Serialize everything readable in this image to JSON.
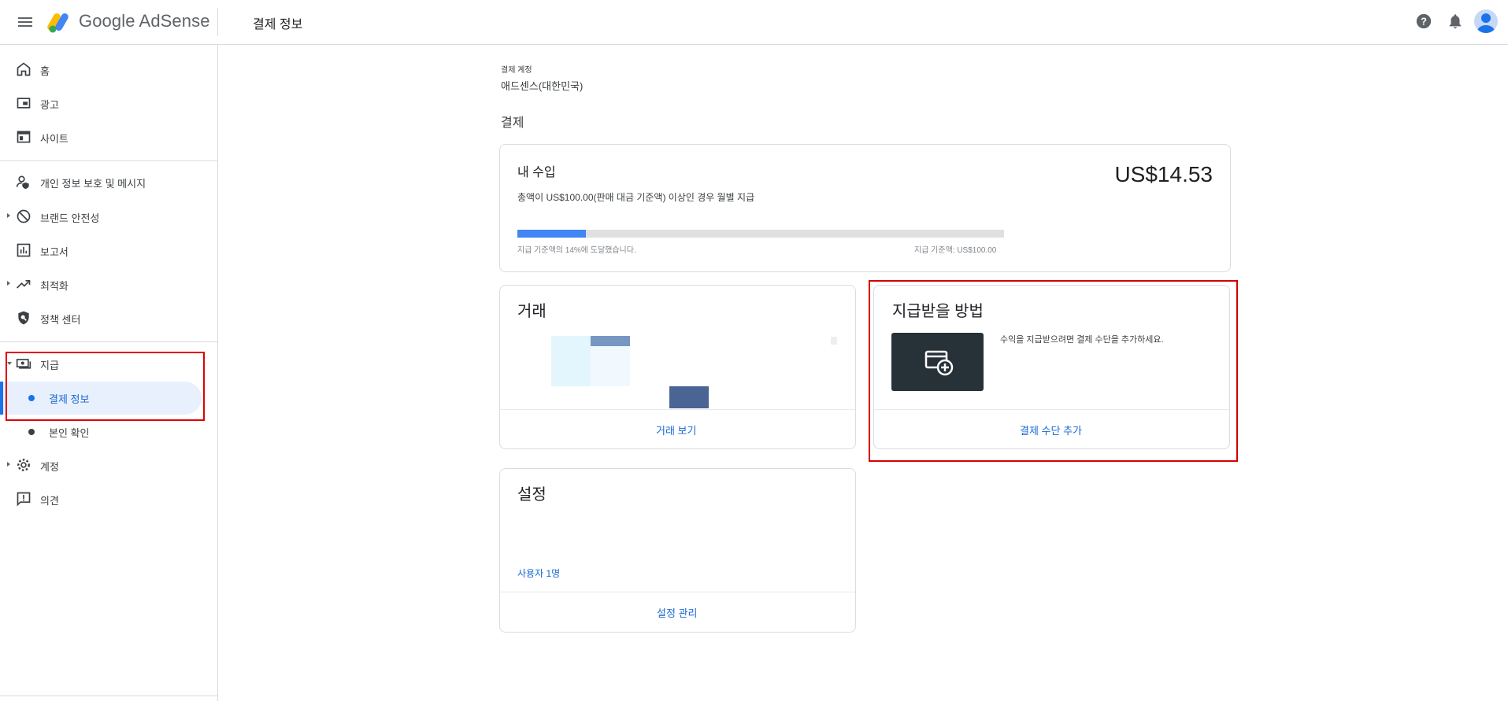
{
  "header": {
    "brand_google": "Google",
    "brand_product": "AdSense",
    "page_title": "결제 정보"
  },
  "sidebar": {
    "items": [
      {
        "label": "홈",
        "icon": "home-icon"
      },
      {
        "label": "광고",
        "icon": "ads-icon"
      },
      {
        "label": "사이트",
        "icon": "sites-icon"
      },
      {
        "label": "개인 정보 보호 및 메시지",
        "icon": "privacy-icon"
      },
      {
        "label": "브랜드 안전성",
        "icon": "block-icon"
      },
      {
        "label": "보고서",
        "icon": "reports-icon"
      },
      {
        "label": "최적화",
        "icon": "trending-icon"
      },
      {
        "label": "정책 센터",
        "icon": "policy-icon"
      },
      {
        "label": "지급",
        "icon": "payments-icon"
      },
      {
        "label": "계정",
        "icon": "gear-icon"
      },
      {
        "label": "의견",
        "icon": "feedback-icon"
      }
    ],
    "sub_items": [
      {
        "label": "결제 정보"
      },
      {
        "label": "본인 확인"
      }
    ]
  },
  "main": {
    "account_label": "결제 계정",
    "account_value": "애드센스(대한민국)",
    "section_title": "결제",
    "earnings": {
      "title": "내 수입",
      "amount": "US$14.53",
      "description": "총액이 US$100.00(판매 대금 기준액) 이상인 경우 월별 지급",
      "progress_percent": 14,
      "progress_text": "지급 기준액의 14%에 도달했습니다.",
      "threshold_text": "지급 기준액: US$100.00"
    },
    "transactions": {
      "title": "거래",
      "link": "거래 보기"
    },
    "payment_method": {
      "title": "지급받을 방법",
      "description": "수익을 지급받으려면 결제 수단을 추가하세요.",
      "link": "결제 수단 추가"
    },
    "settings": {
      "title": "설정",
      "users": "사용자 1명",
      "link": "설정 관리"
    }
  },
  "colors": {
    "accent": "#1a73e8",
    "link": "#1967d2",
    "progress": "#4285f4",
    "highlight_box": "#e00000"
  }
}
